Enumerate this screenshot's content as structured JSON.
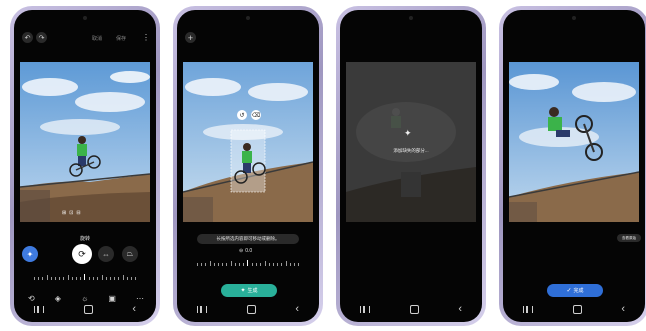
{
  "phone1": {
    "header": {
      "cancel_label": "取消",
      "save_label": "保存"
    },
    "rotate_label": "旋转",
    "tools": [
      "straighten",
      "crop-rotate",
      "flip-horizontal",
      "perspective"
    ],
    "bottom_tools": [
      "adjust-icon",
      "color-icon",
      "filter-icon",
      "sticker-icon",
      "more-icon"
    ]
  },
  "phone2": {
    "hint_text": "长按所选内容即可移动或删除。",
    "angle_label": "0.0",
    "generate_button": "生成"
  },
  "phone3": {
    "status_text": "添加缺失的部分..."
  },
  "phone4": {
    "compare_button": "查看原始",
    "done_button": "完成"
  },
  "colors": {
    "accent_blue": "#3f7be0",
    "generate_teal": "#29b09a",
    "done_blue": "#2f6fd8"
  }
}
